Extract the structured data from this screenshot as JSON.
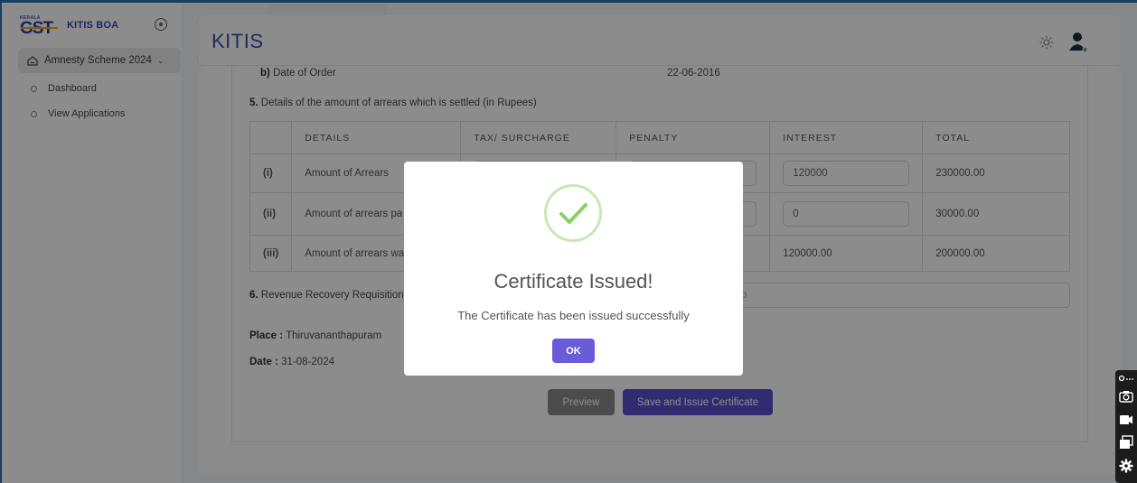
{
  "sidebar": {
    "logo_small": "KERALA",
    "logo_text": "GST",
    "brand_name": "KITIS BOA",
    "menu_main": "Amnesty Scheme 2024",
    "items": [
      {
        "label": "Dashboard"
      },
      {
        "label": "View Applications"
      }
    ]
  },
  "header": {
    "title": "KITIS"
  },
  "form": {
    "order_date_label_prefix": "b)",
    "order_date_label": "Date of Order",
    "order_date_value": "22-06-2016",
    "section5_num": "5.",
    "section5_label": "Details of the amount of arrears which is settled (in Rupees)",
    "table": {
      "headers": [
        "",
        "DETAILS",
        "TAX/ SURCHARGE",
        "PENALTY",
        "INTEREST",
        "TOTAL"
      ],
      "rows": [
        {
          "num": "(i)",
          "detail": "Amount of Arrears",
          "interest": "120000",
          "total": "230000.00"
        },
        {
          "num": "(ii)",
          "detail": "Amount of arrears pa applicant",
          "interest": "0",
          "total": "30000.00"
        },
        {
          "num": "(iii)",
          "detail": "Amount of arrears wa",
          "interest": "120000.00",
          "total": "200000.00"
        }
      ]
    },
    "section6_num": "6.",
    "section6_label": "Revenue Recovery Requisition I",
    "rr_placeholder": "ion No",
    "place_label": "Place :",
    "place_value": "Thiruvananthapuram",
    "date_label": "Date :",
    "date_value": "31-08-2024",
    "preview_btn": "Preview",
    "issue_btn": "Save and Issue Certificate"
  },
  "modal": {
    "title": "Certificate Issued!",
    "message": "The Certificate has been issued successfully",
    "ok": "OK"
  },
  "colors": {
    "brand": "#3548b4",
    "primary_button": "#5a4fd0",
    "success_ring": "#c6e9b4",
    "success_check": "#8ccf6a"
  }
}
